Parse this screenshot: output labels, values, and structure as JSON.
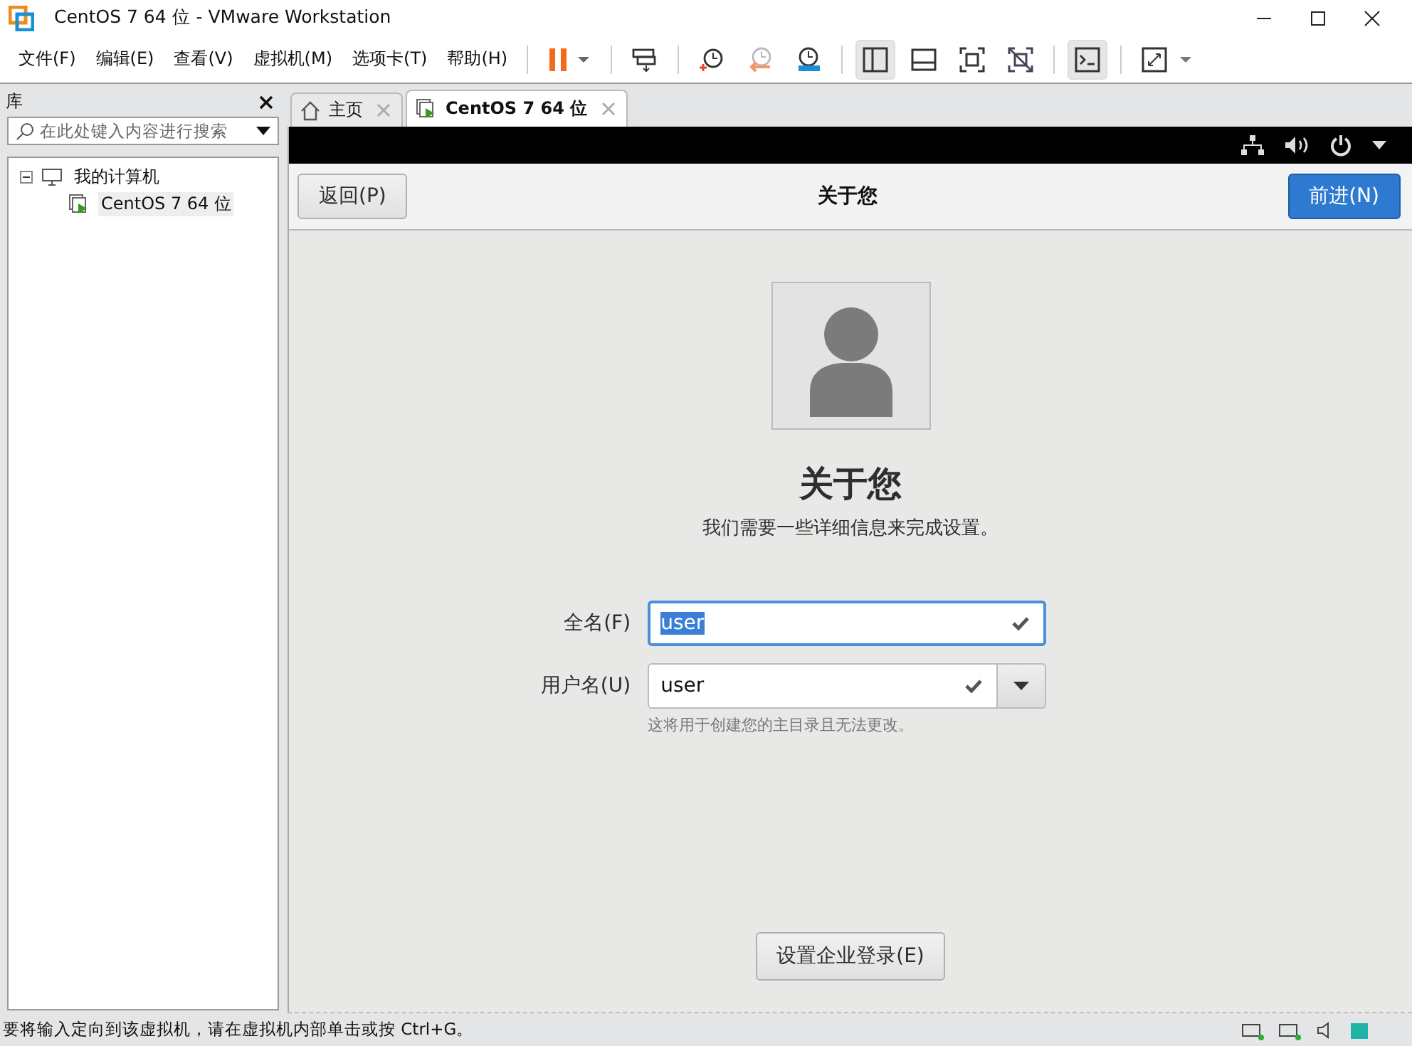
{
  "window": {
    "title": "CentOS 7 64 位 - VMware Workstation"
  },
  "menu": [
    "文件(F)",
    "编辑(E)",
    "查看(V)",
    "虚拟机(M)",
    "选项卡(T)",
    "帮助(H)"
  ],
  "toolbar": [
    {
      "kind": "pause",
      "selected": false
    },
    {
      "kind": "send-keys",
      "selected": false
    },
    {
      "kind": "snapshot",
      "selected": false
    },
    {
      "kind": "revert",
      "selected": false
    },
    {
      "kind": "manager",
      "selected": false
    },
    {
      "kind": "sidebar",
      "selected": true
    },
    {
      "kind": "thumbnail",
      "selected": false
    },
    {
      "kind": "fullscreen",
      "selected": false
    },
    {
      "kind": "unity",
      "selected": false
    },
    {
      "kind": "console",
      "selected": true
    },
    {
      "kind": "stretch",
      "selected": false
    }
  ],
  "library": {
    "title": "库",
    "search": {
      "placeholder": "在此处键入内容进行搜索"
    },
    "tree": [
      {
        "label": "我的计算机",
        "expanded": true,
        "selected": false,
        "children": [
          {
            "label": "CentOS 7 64 位",
            "selected": true
          }
        ]
      }
    ]
  },
  "tabs": [
    {
      "kind": "home",
      "label": "主页",
      "selected": false
    },
    {
      "kind": "vm",
      "label": "CentOS 7 64 位",
      "selected": true
    }
  ],
  "guest": {
    "header": {
      "back": "返回(P)",
      "title": "关于您",
      "next": "前进(N)"
    },
    "heading": "关于您",
    "subtitle": "我们需要一些详细信息来完成设置。",
    "fields": [
      {
        "label": "全名(F)",
        "value": "user",
        "focused": true,
        "dropdown": false
      },
      {
        "label": "用户名(U)",
        "value": "user",
        "focused": false,
        "dropdown": true
      }
    ],
    "hint": "这将用于创建您的主目录且无法更改。",
    "enterprise_button": "设置企业登录(E)"
  },
  "status_bar": "要将输入定向到该虚拟机，请在虚拟机内部单击或按 Ctrl+G。"
}
